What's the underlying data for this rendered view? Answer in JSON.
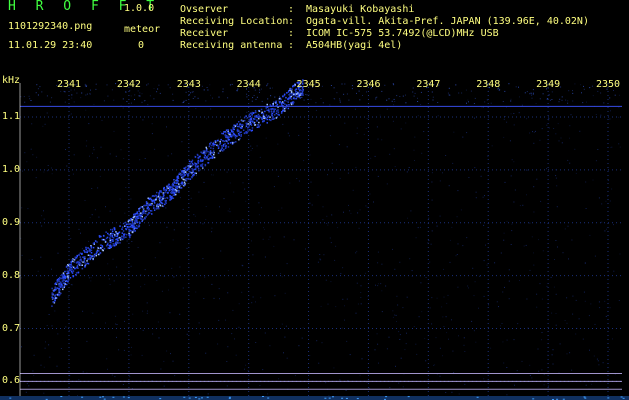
{
  "app": {
    "title": "H R O F F T",
    "version": "1.0.0",
    "file_name": "1101292340.png",
    "timestamp": "11.01.29 23:40",
    "mode_label": "meteor",
    "mode_count": "0"
  },
  "meta": [
    {
      "key": "Ovserver",
      "value": "Masayuki Kobayashi"
    },
    {
      "key": "Receiving Location",
      "value": "Ogata-vill. Akita-Pref. JAPAN (139.96E, 40.02N)"
    },
    {
      "key": "Receiver",
      "value": "ICOM IC-575 53.7492(@LCD)MHz USB"
    },
    {
      "key": "Receiving antenna",
      "value": "A504HB(yagi 4el)"
    }
  ],
  "colors": {
    "background": "#000000",
    "text": "#ffff80",
    "title": "#40ff40",
    "signal": "#2b4cff",
    "grid": "#1a2f7a",
    "reference_line": "#c8b9ff"
  },
  "chart_data": {
    "type": "heatmap",
    "ylabel": "kHz",
    "x_ticks": [
      "2341",
      "2342",
      "2343",
      "2344",
      "2345",
      "2346",
      "2347",
      "2348",
      "2349",
      "2350"
    ],
    "y_ticks": [
      "1.1",
      "1.0",
      "0.9",
      "0.8",
      "0.7",
      "0.6"
    ],
    "xlim": [
      2340.5,
      2350.3
    ],
    "ylim": [
      0.57,
      1.18
    ],
    "signal_trace": [
      {
        "x": 2340.7,
        "y": 0.76
      },
      {
        "x": 2341.0,
        "y": 0.81
      },
      {
        "x": 2341.5,
        "y": 0.86
      },
      {
        "x": 2342.0,
        "y": 0.89
      },
      {
        "x": 2342.3,
        "y": 0.93
      },
      {
        "x": 2342.7,
        "y": 0.96
      },
      {
        "x": 2343.0,
        "y": 1.0
      },
      {
        "x": 2343.5,
        "y": 1.05
      },
      {
        "x": 2344.0,
        "y": 1.09
      },
      {
        "x": 2344.5,
        "y": 1.12
      },
      {
        "x": 2344.9,
        "y": 1.16
      }
    ],
    "horizontal_lines_khz": [
      1.12,
      0.615,
      0.6,
      0.585
    ],
    "grid": true
  }
}
